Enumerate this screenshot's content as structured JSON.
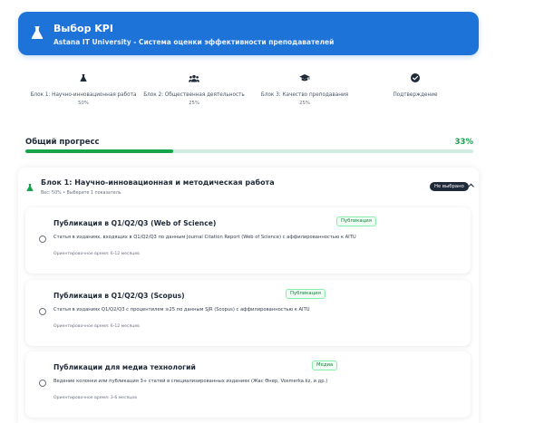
{
  "header": {
    "title": "Выбор KPI",
    "subtitle": "Astana IT University - Система оценки эффективности преподавателей",
    "icon": "flask-icon",
    "color": "#1e73d8"
  },
  "steps": [
    {
      "label": "Блок 1: Научно-инновационная работа",
      "pct": "50%",
      "icon": "flask-icon",
      "active": true
    },
    {
      "label": "Блок 2: Общественная деятельность",
      "pct": "25%",
      "icon": "users-icon",
      "active": false
    },
    {
      "label": "Блок 3: Качество преподавания",
      "pct": "25%",
      "icon": "graduation-cap-icon",
      "active": false
    },
    {
      "label": "Подтверждение",
      "pct": "",
      "icon": "check-circle-icon",
      "active": false
    }
  ],
  "progress": {
    "label": "Общий прогресс",
    "value": "33%",
    "fraction": 0.33,
    "color": "#16a34a"
  },
  "block": {
    "title": "Блок 1: Научно-инновационная и методическая работа",
    "meta": "Вес: 50% • Выберите 1 показатель",
    "status": "Не выбрано",
    "icon": "flask-icon"
  },
  "options": [
    {
      "title": "Публикация в Q1/Q2/Q3 (Web of Science)",
      "tag": "Публикация",
      "description": "Статья в изданиях, входящих в Q1/Q2/Q3 по данным Journal Citation Report (Web of Science) с аффилированностью к AITU",
      "time": "Ориентировочное время: 6-12 месяцев"
    },
    {
      "title": "Публикация в Q1/Q2/Q3 (Scopus)",
      "tag": "Публикация",
      "description": "Статья в изданиях Q1/Q2/Q3 с процентилем ≥25 по данным SJR (Scopus) с аффилированностью к AITU",
      "time": "Ориентировочное время: 6-12 месяцев"
    },
    {
      "title": "Публикации для медиа технологий",
      "tag": "Медиа",
      "description": "Ведение колонки или публикация 3+ статей в специализированных изданиях (Жас Өнер, Vosmerka.kz, и др.)",
      "time": "Ориентировочное время: 3-6 месяцев"
    }
  ]
}
